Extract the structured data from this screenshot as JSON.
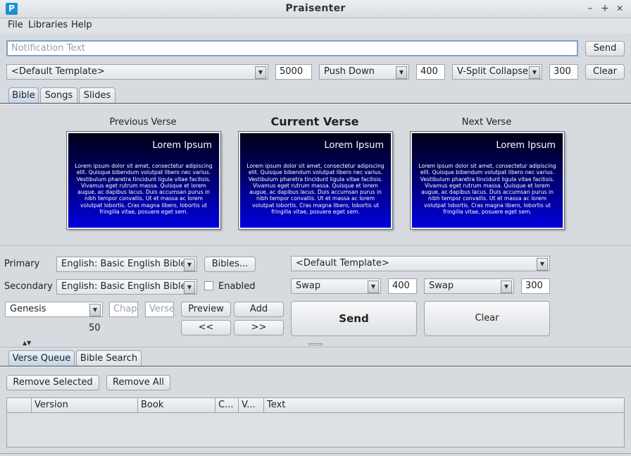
{
  "window": {
    "title": "Praisenter",
    "icon_letter": "P",
    "minimize": "–",
    "maximize": "+",
    "close": "✕"
  },
  "menu": [
    "File",
    "Libraries",
    "Help"
  ],
  "notification": {
    "placeholder": "Notification Text",
    "send_label": "Send",
    "template": "<Default Template>",
    "duration": "5000",
    "in_transition": "Push Down",
    "in_duration": "400",
    "out_transition": "V-Split Collapse",
    "out_duration": "300",
    "clear_label": "Clear"
  },
  "tabs": [
    "Bible",
    "Songs",
    "Slides"
  ],
  "active_tab": "Bible",
  "preview": {
    "previous_label": "Previous Verse",
    "current_label": "Current Verse",
    "next_label": "Next Verse",
    "slide_title": "Lorem Ipsum",
    "slide_body": "Lorem ipsum dolor sit amet, consectetur adipiscing elit. Quisque bibendum volutpat libero nec varius. Vestibulum pharetra tincidunt ligula vitae facilisis. Vivamus eget rutrum massa. Quisque et lorem augue, ac dapibus lacus. Duis accumsan purus in nibh tempor convallis. Ut et massa ac lorem volutpat lobortis. Cras magna libero, lobortis ut fringilla vitae, posuere eget sem."
  },
  "bible": {
    "primary_label": "Primary",
    "primary_value": "English: Basic English Bible",
    "bibles_button": "Bibles...",
    "secondary_label": "Secondary",
    "secondary_value": "English: Basic English Bible",
    "enabled_label": "Enabled",
    "book_value": "Genesis",
    "chapter_placeholder": "Chapt",
    "verse_placeholder": "Verse",
    "chapter_count": "50",
    "preview_button": "Preview",
    "add_button": "Add",
    "prev_button": "<<",
    "next_button": ">>",
    "template": "<Default Template>",
    "in_transition": "Swap",
    "in_duration": "400",
    "out_transition": "Swap",
    "out_duration": "300",
    "send_button": "Send",
    "clear_button": "Clear"
  },
  "bottom_tabs": [
    "Verse Queue",
    "Bible Search"
  ],
  "queue": {
    "remove_selected": "Remove Selected",
    "remove_all": "Remove All",
    "columns": [
      "",
      "Version",
      "Book",
      "C...",
      "V...",
      "Text"
    ]
  }
}
